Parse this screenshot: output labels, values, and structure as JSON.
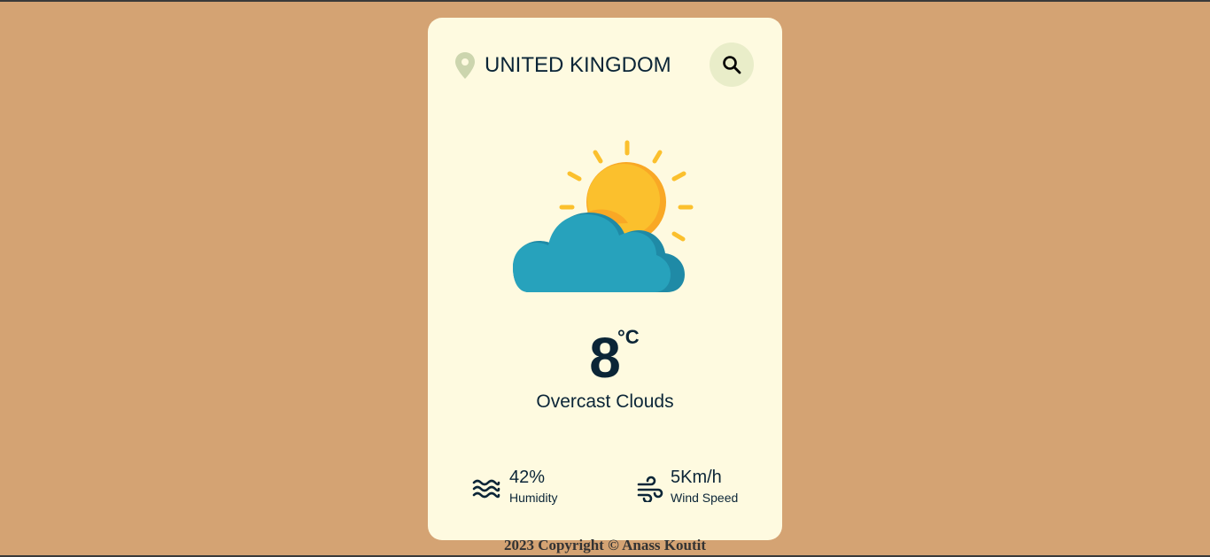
{
  "search": {
    "value": "UNITED KINGDOM",
    "pin_icon": "location-pin-icon",
    "button_icon": "search-icon"
  },
  "weather": {
    "image_icon": "partly-cloudy-icon",
    "temperature": "8",
    "unit": "°C",
    "description": "Overcast Clouds"
  },
  "details": {
    "humidity": {
      "icon": "waves-icon",
      "value": "42%",
      "label": "Humidity"
    },
    "wind": {
      "icon": "wind-icon",
      "value": "5Km/h",
      "label": "Wind Speed"
    }
  },
  "footer": {
    "text": "2023 Copyright © Anass Koutit"
  },
  "colors": {
    "background": "#d4a373",
    "card": "#fefae0",
    "button": "#e9edc9",
    "text": "#0b2537"
  }
}
